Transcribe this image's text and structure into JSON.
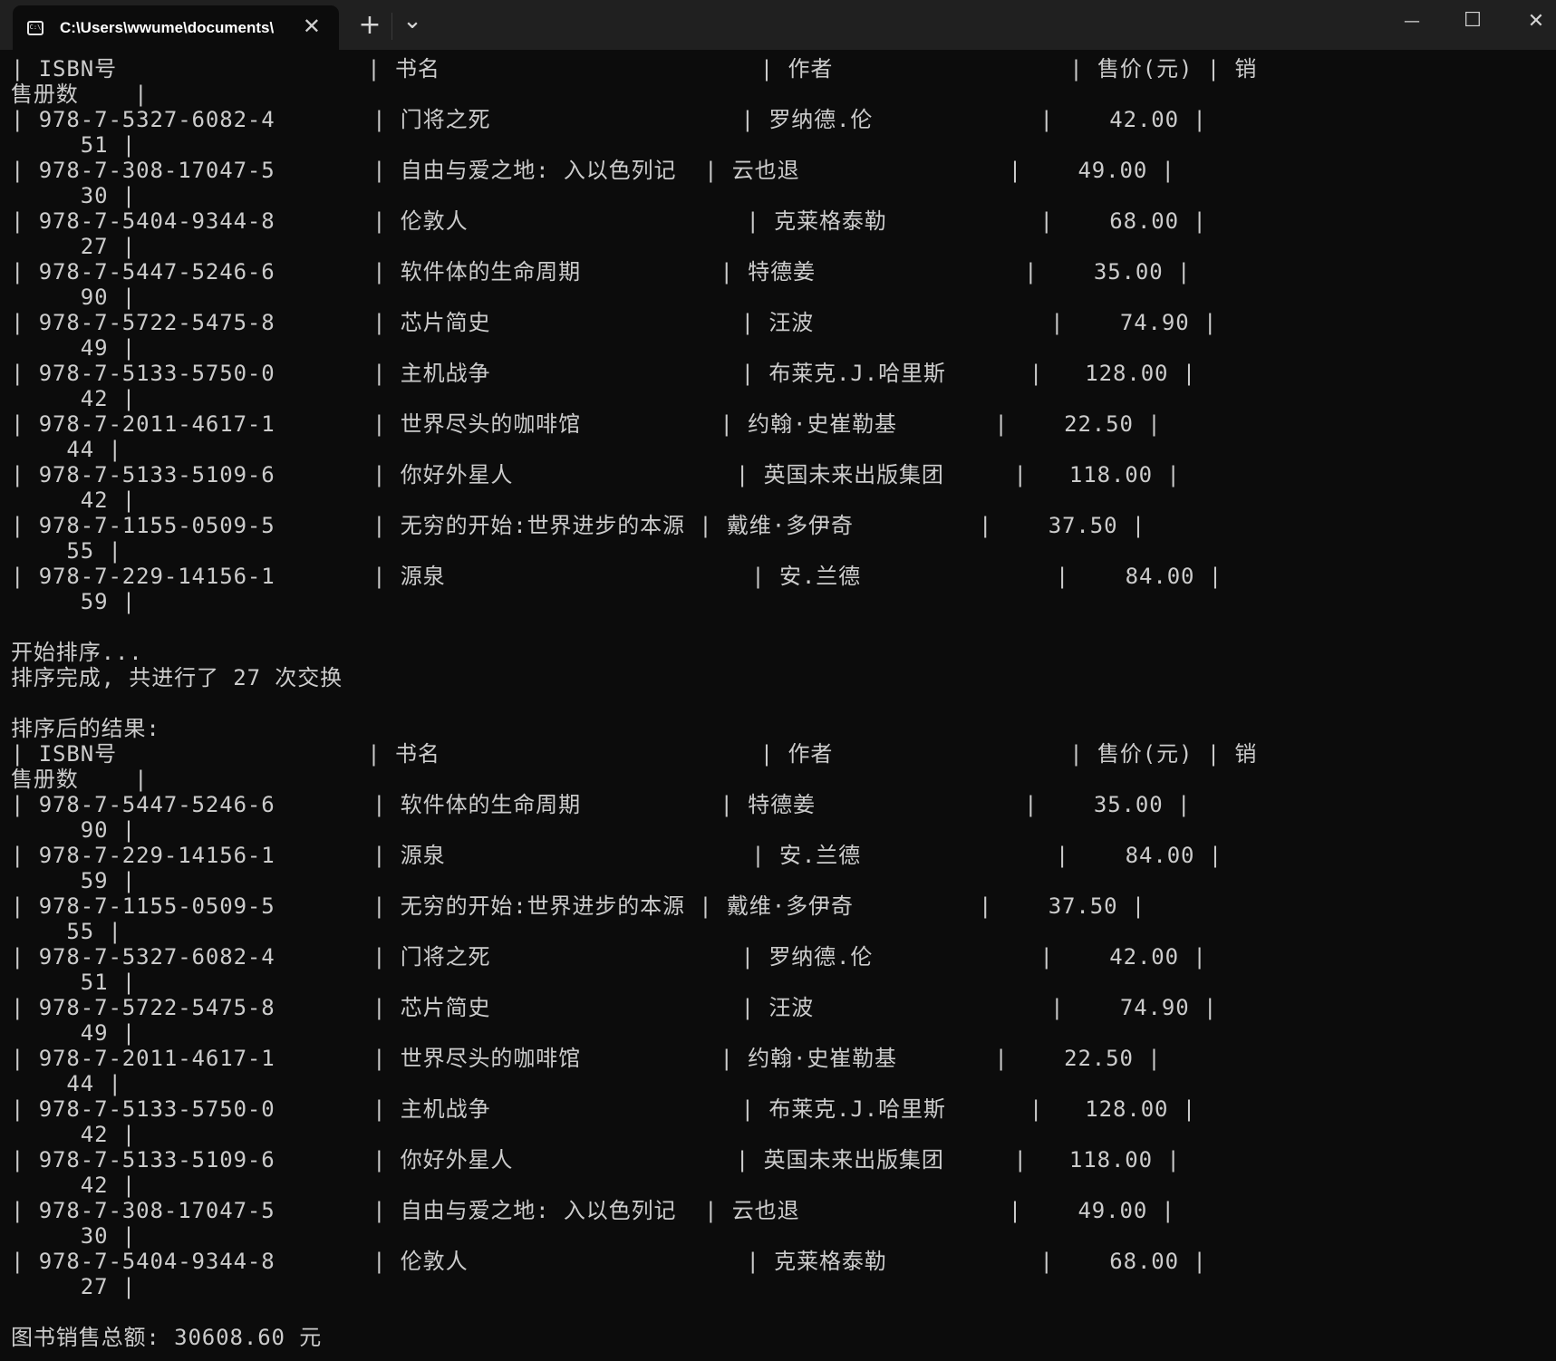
{
  "window": {
    "tab_title": "C:\\Users\\wwume\\documents\\",
    "tab_icon": "terminal-icon",
    "icons": {
      "close_tab": "✕",
      "new_tab": "+",
      "dropdown": "⌄",
      "minimize": "—",
      "maximize": "☐",
      "close_window": "✕"
    }
  },
  "terminal": {
    "lines": [
      "| ISBN号                  | 书名                       | 作者                 | 售价(元) | 销",
      "售册数    |",
      "| 978-7-5327-6082-4       | 门将之死                  | 罗纳德.伦            |    42.00 |",
      "     51 |",
      "| 978-7-308-17047-5       | 自由与爱之地: 入以色列记  | 云也退               |    49.00 |",
      "     30 |",
      "| 978-7-5404-9344-8       | 伦敦人                    | 克莱格泰勒           |    68.00 |",
      "     27 |",
      "| 978-7-5447-5246-6       | 软件体的生命周期          | 特德姜               |    35.00 |",
      "     90 |",
      "| 978-7-5722-5475-8       | 芯片简史                  | 汪波                 |    74.90 |",
      "     49 |",
      "| 978-7-5133-5750-0       | 主机战争                  | 布莱克.J.哈里斯      |   128.00 |",
      "     42 |",
      "| 978-7-2011-4617-1       | 世界尽头的咖啡馆          | 约翰·史崔勒基       |    22.50 |",
      "    44 |",
      "| 978-7-5133-5109-6       | 你好外星人                | 英国未来出版集团     |   118.00 |",
      "     42 |",
      "| 978-7-1155-0509-5       | 无穷的开始:世界进步的本源 | 戴维·多伊奇         |    37.50 |",
      "    55 |",
      "| 978-7-229-14156-1       | 源泉                      | 安.兰德              |    84.00 |",
      "     59 |",
      "",
      "开始排序...",
      "排序完成, 共进行了 27 次交换",
      "",
      "排序后的结果:",
      "| ISBN号                  | 书名                       | 作者                 | 售价(元) | 销",
      "售册数    |",
      "| 978-7-5447-5246-6       | 软件体的生命周期          | 特德姜               |    35.00 |",
      "     90 |",
      "| 978-7-229-14156-1       | 源泉                      | 安.兰德              |    84.00 |",
      "     59 |",
      "| 978-7-1155-0509-5       | 无穷的开始:世界进步的本源 | 戴维·多伊奇         |    37.50 |",
      "    55 |",
      "| 978-7-5327-6082-4       | 门将之死                  | 罗纳德.伦            |    42.00 |",
      "     51 |",
      "| 978-7-5722-5475-8       | 芯片简史                  | 汪波                 |    74.90 |",
      "     49 |",
      "| 978-7-2011-4617-1       | 世界尽头的咖啡馆          | 约翰·史崔勒基       |    22.50 |",
      "    44 |",
      "| 978-7-5133-5750-0       | 主机战争                  | 布莱克.J.哈里斯      |   128.00 |",
      "     42 |",
      "| 978-7-5133-5109-6       | 你好外星人                | 英国未来出版集团     |   118.00 |",
      "     42 |",
      "| 978-7-308-17047-5       | 自由与爱之地: 入以色列记  | 云也退               |    49.00 |",
      "     30 |",
      "| 978-7-5404-9344-8       | 伦敦人                    | 克莱格泰勒           |    68.00 |",
      "     27 |",
      "",
      "图书销售总额: 30608.60 元"
    ]
  },
  "colors": {
    "background": "#0c0c0c",
    "titlebar": "#202020",
    "text": "#cccccc"
  }
}
